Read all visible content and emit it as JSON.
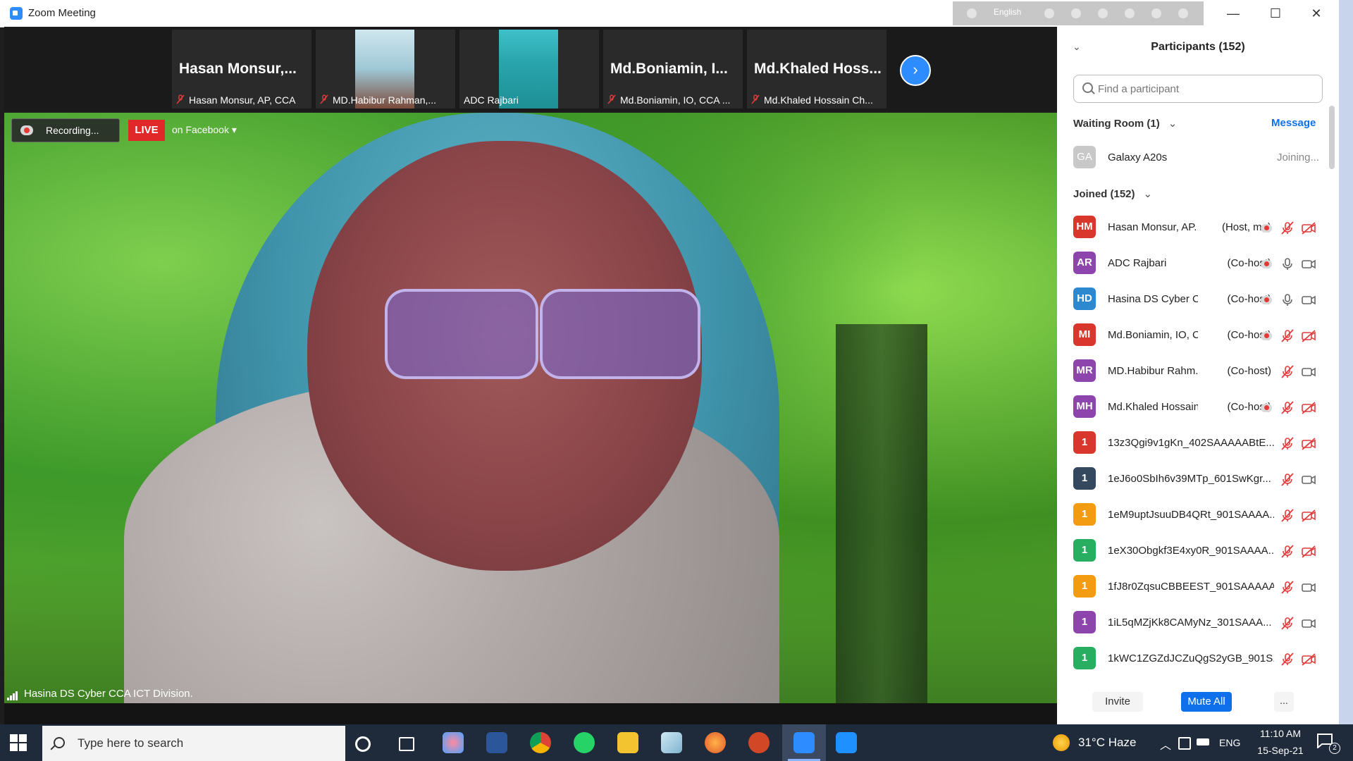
{
  "window": {
    "title": "Zoom Meeting",
    "langbar_label": "English",
    "minimize": "—",
    "maximize": "☐",
    "close": "✕"
  },
  "gallery": [
    {
      "big": "Hasan  Monsur,...",
      "caption": "Hasan Monsur, AP, CCA",
      "muted": true,
      "video": false
    },
    {
      "big": "",
      "caption": "MD.Habibur Rahman,...",
      "muted": true,
      "video": true
    },
    {
      "big": "",
      "caption": "ADC Rajbari",
      "muted": false,
      "video": true
    },
    {
      "big": "Md.Boniamin,  I...",
      "caption": "Md.Boniamin, IO, CCA ...",
      "muted": true,
      "video": false
    },
    {
      "big": "Md.Khaled  Hoss...",
      "caption": "Md.Khaled Hossain Ch...",
      "muted": true,
      "video": false
    }
  ],
  "main": {
    "recording": "Recording...",
    "live": "LIVE",
    "live_target": "on Facebook ▾",
    "speaker": "Hasina DS Cyber CCA ICT Division."
  },
  "panel": {
    "title": "Participants (152)",
    "find_placeholder": "Find a participant",
    "waiting_label": "Waiting Room (1)",
    "message": "Message",
    "waiting": [
      {
        "initials": "GA",
        "name": "Galaxy A20s",
        "status": "Joining..."
      }
    ],
    "joined_label": "Joined (152)",
    "joined": [
      {
        "initials": "HM",
        "color": "#d9372b",
        "name": "Hasan Monsur, AP...",
        "role": "(Host, me)",
        "rec": true,
        "mic": "off",
        "cam": "off"
      },
      {
        "initials": "AR",
        "color": "#8e44ad",
        "name": "ADC Rajbari",
        "role": "(Co-host)",
        "rec": true,
        "mic": "on",
        "cam": "on"
      },
      {
        "initials": "HD",
        "color": "#2d89cf",
        "name": "Hasina DS Cyber C...",
        "role": "(Co-host)",
        "rec": true,
        "mic": "on",
        "cam": "on"
      },
      {
        "initials": "MI",
        "color": "#d9372b",
        "name": "Md.Boniamin, IO, C...",
        "role": "(Co-host)",
        "rec": true,
        "mic": "off",
        "cam": "off"
      },
      {
        "initials": "MR",
        "color": "#8e44ad",
        "name": "MD.Habibur Rahm...",
        "role": "(Co-host)",
        "rec": false,
        "mic": "off",
        "cam": "on"
      },
      {
        "initials": "MH",
        "color": "#8e44ad",
        "name": "Md.Khaled Hossain...",
        "role": "(Co-host)",
        "rec": true,
        "mic": "off",
        "cam": "off"
      },
      {
        "initials": "1",
        "color": "#d9372b",
        "name": "13z3Qgi9v1gKn_402SAAAAABtE...",
        "role": "",
        "rec": false,
        "mic": "off",
        "cam": "off"
      },
      {
        "initials": "1",
        "color": "#34495e",
        "name": "1eJ6o0SbIh6v39MTp_601SwKgr...",
        "role": "",
        "rec": false,
        "mic": "off",
        "cam": "on"
      },
      {
        "initials": "1",
        "color": "#f39c12",
        "name": "1eM9uptJsuuDB4QRt_901SAAAA...",
        "role": "",
        "rec": false,
        "mic": "off",
        "cam": "off"
      },
      {
        "initials": "1",
        "color": "#27ae60",
        "name": "1eX30Obgkf3E4xy0R_901SAAAA...",
        "role": "",
        "rec": false,
        "mic": "off",
        "cam": "off"
      },
      {
        "initials": "1",
        "color": "#f39c12",
        "name": "1fJ8r0ZqsuCBBEEST_901SAAAAA...",
        "role": "",
        "rec": false,
        "mic": "off",
        "cam": "on"
      },
      {
        "initials": "1",
        "color": "#8e44ad",
        "name": "1iL5qMZjKk8CAMyNz_301SAAA...",
        "role": "",
        "rec": false,
        "mic": "off",
        "cam": "on"
      },
      {
        "initials": "1",
        "color": "#27ae60",
        "name": "1kWC1ZGZdJCZuQgS2yGB_901S...",
        "role": "",
        "rec": false,
        "mic": "off",
        "cam": "off"
      }
    ],
    "invite": "Invite",
    "mute_all": "Mute All",
    "more": "..."
  },
  "taskbar": {
    "search_placeholder": "Type here to search",
    "weather": "31°C  Haze",
    "tray_up": "︿",
    "lang": "ENG",
    "time": "11:10 AM",
    "date": "15-Sep-21",
    "notifications": "2"
  }
}
